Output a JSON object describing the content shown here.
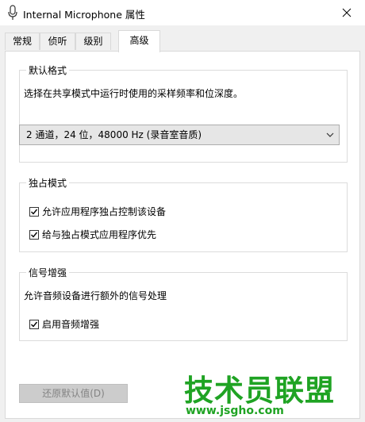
{
  "window": {
    "title": "Internal Microphone 属性",
    "icon": "microphone-icon"
  },
  "tabs": [
    {
      "label": "常规"
    },
    {
      "label": "侦听"
    },
    {
      "label": "级别"
    },
    {
      "label": "高级"
    }
  ],
  "default_format": {
    "group_label": "默认格式",
    "description": "选择在共享模式中运行时使用的采样频率和位深度。",
    "selected": "2 通道，24 位，48000 Hz (录音室音质)"
  },
  "exclusive": {
    "group_label": "独占模式",
    "options": [
      {
        "label": "允许应用程序独占控制该设备",
        "checked": true
      },
      {
        "label": "给与独占模式应用程序优先",
        "checked": true
      }
    ]
  },
  "enhancement": {
    "group_label": "信号增强",
    "description": "允许音频设备进行额外的信号处理",
    "option": {
      "label": "启用音频增强",
      "checked": true
    }
  },
  "restore_button": {
    "label": "还原默认值(D)"
  },
  "watermark": {
    "text": "技术员联盟",
    "url": "www.jsgho.com"
  },
  "colors": {
    "watermark": "#1fa323",
    "window_bg": "#f0f0f0",
    "panel_bg": "#ffffff"
  }
}
